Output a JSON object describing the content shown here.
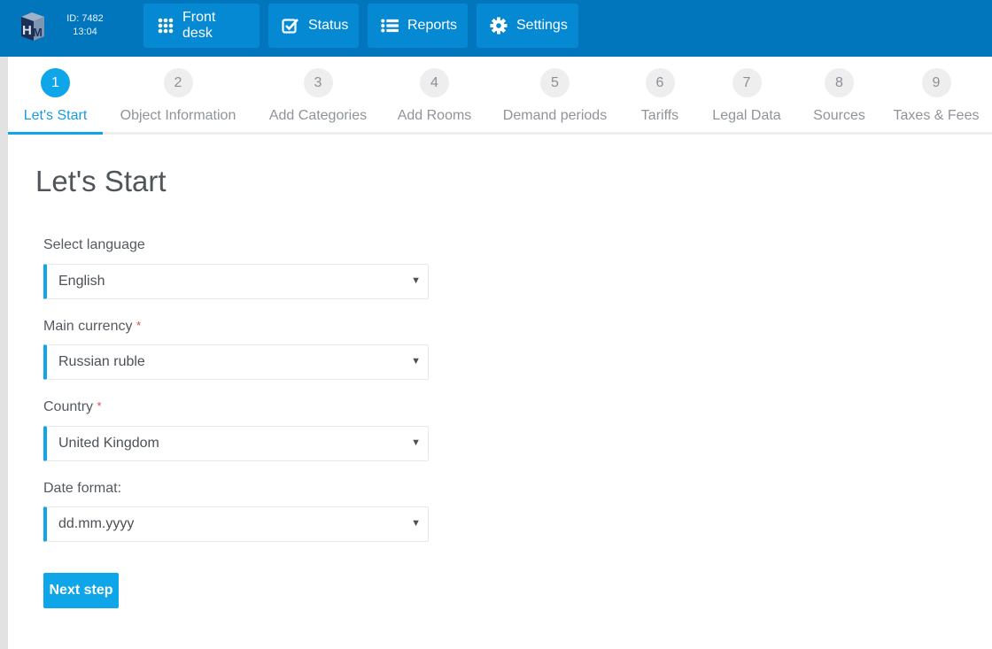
{
  "header": {
    "logo": "HM",
    "session_id": "ID: 7482",
    "time": "13:04",
    "nav": [
      {
        "label": "Front desk",
        "icon": "grid-icon"
      },
      {
        "label": "Status",
        "icon": "checkbox-icon"
      },
      {
        "label": "Reports",
        "icon": "list-icon"
      },
      {
        "label": "Settings",
        "icon": "gear-icon"
      }
    ],
    "colors": {
      "bar": "#0276bd",
      "button": "#0689d3"
    }
  },
  "stepper": {
    "active_index": 0,
    "steps": [
      {
        "num": "1",
        "label": "Let's Start"
      },
      {
        "num": "2",
        "label": "Object Information"
      },
      {
        "num": "3",
        "label": "Add Categories"
      },
      {
        "num": "4",
        "label": "Add Rooms"
      },
      {
        "num": "5",
        "label": "Demand periods"
      },
      {
        "num": "6",
        "label": "Tariffs"
      },
      {
        "num": "7",
        "label": "Legal Data"
      },
      {
        "num": "8",
        "label": "Sources"
      },
      {
        "num": "9",
        "label": "Taxes & Fees"
      }
    ],
    "accent": "#0ea5e9"
  },
  "form": {
    "title": "Let's Start",
    "required_mark": "*",
    "fields": [
      {
        "label": "Select language",
        "required": false,
        "value": "English"
      },
      {
        "label": "Main currency",
        "required": true,
        "value": "Russian ruble"
      },
      {
        "label": "Country",
        "required": true,
        "value": "United Kingdom"
      },
      {
        "label": "Date format:",
        "required": false,
        "value": "dd.mm.yyyy"
      }
    ],
    "caret": "▼",
    "next_label": "Next step"
  }
}
